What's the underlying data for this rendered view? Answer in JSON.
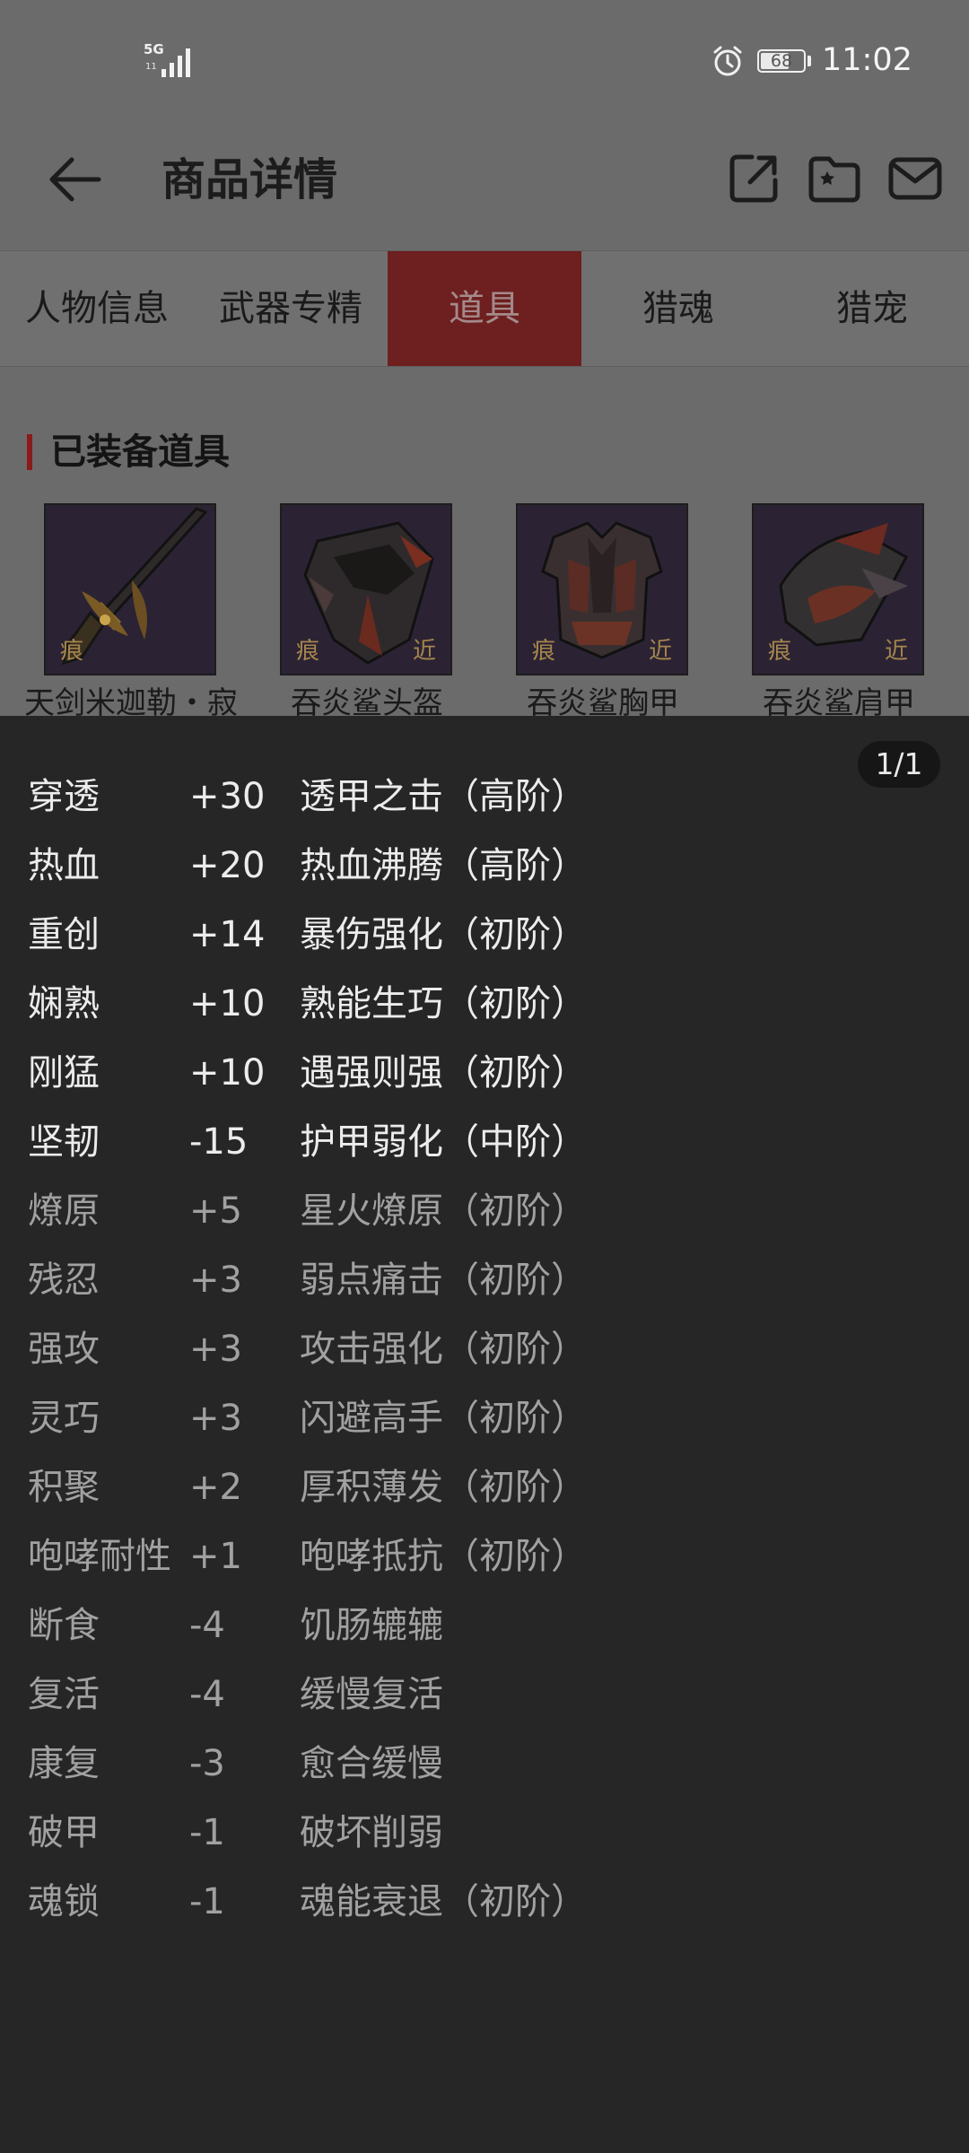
{
  "status_bar": {
    "network_label": "5G",
    "network_sub": "11",
    "battery_level": "68",
    "battery_fraction": 0.68,
    "time": "11:02",
    "icons": [
      "signal-icon",
      "alarm-icon",
      "battery-icon"
    ]
  },
  "header": {
    "title": "商品详情",
    "icons": [
      "back-arrow-icon",
      "share-icon",
      "favorite-folder-icon",
      "message-icon"
    ]
  },
  "tabs": [
    {
      "label": "人物信息",
      "active": false
    },
    {
      "label": "武器专精",
      "active": false
    },
    {
      "label": "道具",
      "active": true
    },
    {
      "label": "猎魂",
      "active": false
    },
    {
      "label": "猎宠",
      "active": false
    }
  ],
  "section": {
    "title": "已装备道具"
  },
  "items": [
    {
      "name": "天剑米迦勒・寂",
      "badge_left": "痕",
      "badge_right": "",
      "icon": "sword-icon"
    },
    {
      "name": "吞炎鲨头盔",
      "badge_left": "痕",
      "badge_right": "近",
      "icon": "helmet-icon"
    },
    {
      "name": "吞炎鲨胸甲",
      "badge_left": "痕",
      "badge_right": "近",
      "icon": "chest-armor-icon"
    },
    {
      "name": "吞炎鲨肩甲",
      "badge_left": "痕",
      "badge_right": "近",
      "icon": "shoulder-armor-icon"
    }
  ],
  "sheet": {
    "page_indicator": "1/1",
    "rows": [
      {
        "name": "穿透",
        "value": "+30",
        "skill": "透甲之击（高阶）",
        "bright": true
      },
      {
        "name": "热血",
        "value": "+20",
        "skill": "热血沸腾（高阶）",
        "bright": true
      },
      {
        "name": "重创",
        "value": "+14",
        "skill": "暴伤强化（初阶）",
        "bright": true
      },
      {
        "name": "娴熟",
        "value": "+10",
        "skill": "熟能生巧（初阶）",
        "bright": true
      },
      {
        "name": "刚猛",
        "value": "+10",
        "skill": "遇强则强（初阶）",
        "bright": true
      },
      {
        "name": "坚韧",
        "value": "-15",
        "skill": "护甲弱化（中阶）",
        "bright": true
      },
      {
        "name": "燎原",
        "value": "+5",
        "skill": "星火燎原（初阶）",
        "bright": false
      },
      {
        "name": "残忍",
        "value": "+3",
        "skill": "弱点痛击（初阶）",
        "bright": false
      },
      {
        "name": "强攻",
        "value": "+3",
        "skill": "攻击强化（初阶）",
        "bright": false
      },
      {
        "name": "灵巧",
        "value": "+3",
        "skill": "闪避高手（初阶）",
        "bright": false
      },
      {
        "name": "积聚",
        "value": "+2",
        "skill": "厚积薄发（初阶）",
        "bright": false
      },
      {
        "name": "咆哮耐性",
        "value": "+1",
        "skill": "咆哮抵抗（初阶）",
        "bright": false
      },
      {
        "name": "断食",
        "value": "-4",
        "skill": "饥肠辘辘",
        "bright": false
      },
      {
        "name": "复活",
        "value": "-4",
        "skill": "缓慢复活",
        "bright": false
      },
      {
        "name": "康复",
        "value": "-3",
        "skill": "愈合缓慢",
        "bright": false
      },
      {
        "name": "破甲",
        "value": "-1",
        "skill": "破坏削弱",
        "bright": false
      },
      {
        "name": "魂锁",
        "value": "-1",
        "skill": "魂能衰退（初阶）",
        "bright": false
      }
    ]
  },
  "colors": {
    "overlay_bg": "#6b6b6b",
    "sheet_bg": "#262626",
    "active_tab": "#6e1f1f",
    "accent_bar": "#8a1b1b",
    "text_bright": "#ececec",
    "text_dim": "#a1a1a1"
  }
}
